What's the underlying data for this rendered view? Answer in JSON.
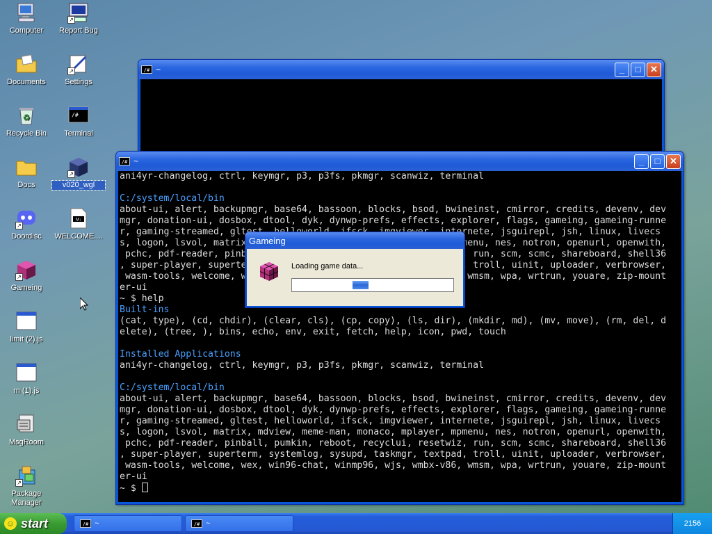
{
  "desktop": {
    "icons": [
      {
        "label": "Computer",
        "icon": "computer-icon"
      },
      {
        "label": "Report Bug",
        "icon": "report-bug-icon"
      },
      {
        "label": "Documents",
        "icon": "documents-icon"
      },
      {
        "label": "Settings",
        "icon": "settings-icon"
      },
      {
        "label": "Recycle Bin",
        "icon": "recycle-bin-icon"
      },
      {
        "label": "Terminal",
        "icon": "terminal-icon"
      },
      {
        "label": "Docs",
        "icon": "folder-icon"
      },
      {
        "label": "v020_wgl",
        "icon": "cube-icon"
      },
      {
        "label": "Doordisc",
        "icon": "doordisc-icon"
      },
      {
        "label": "WELCOME....",
        "icon": "markdown-file-icon"
      },
      {
        "label": "Gameing",
        "icon": "gameing-icon"
      },
      {
        "label": "limit (2).js",
        "icon": "js-file-icon"
      },
      {
        "label": "m (1).js",
        "icon": "js-file-icon"
      },
      {
        "label": "MsgRoom",
        "icon": "msgroom-icon"
      },
      {
        "label": "Package Manager",
        "icon": "package-manager-icon"
      }
    ]
  },
  "back_window": {
    "title": "~",
    "app_icon": "/#"
  },
  "front_window": {
    "title": "~",
    "app_icon": "/#",
    "lines": [
      {
        "text": "ani4yr-changelog, ctrl, keymgr, p3, p3fs, pkmgr, scanwiz, terminal",
        "style": "normal"
      },
      {
        "text": "",
        "style": "normal"
      },
      {
        "text": "C:/system/local/bin",
        "style": "blue"
      },
      {
        "text": "about-ui, alert, backupmgr, base64, bassoon, blocks, bsod, bwineinst, cmirror, credits, devenv, dev",
        "style": "normal"
      },
      {
        "text": "mgr, donation-ui, dosbox, dtool, dyk, dynwp-prefs, effects, explorer, flags, gameing, gameing-runne",
        "style": "normal"
      },
      {
        "text": "r, gaming-streamed, gltest, helloworld, ifsck, imgviewer, internete, jsguirepl, jsh, linux, livecs",
        "style": "normal"
      },
      {
        "text": "s, logon, lsvol, matrix, mdview, meme-man, monaco, mplayer, mpmenu, nes, notron, openurl, openwith,",
        "style": "normal"
      },
      {
        "text": " pchc, pdf-reader, pinball, pumkin, reboot, recyclui, resetwiz, run, scm, scmc, shareboard, shell36",
        "style": "normal"
      },
      {
        "text": ", super-player, superterm, systemlog, sysupd, taskmgr, textpad, troll, uinit, uploader, verbrowser,",
        "style": "normal"
      },
      {
        "text": " wasm-tools, welcome, wex, win96-chat, winmp96, wjs, wmbx-v86, wmsm, wpa, wrtrun, youare, zip-mount",
        "style": "normal"
      },
      {
        "text": "er-ui",
        "style": "normal"
      },
      {
        "text": "~ $ help",
        "style": "normal"
      },
      {
        "text": "Built-ins",
        "style": "blue"
      },
      {
        "text": "(cat, type), (cd, chdir), (clear, cls), (cp, copy), (ls, dir), (mkdir, md), (mv, move), (rm, del, d",
        "style": "normal"
      },
      {
        "text": "elete), (tree, ), bins, echo, env, exit, fetch, help, icon, pwd, touch",
        "style": "normal"
      },
      {
        "text": "",
        "style": "normal"
      },
      {
        "text": "Installed Applications",
        "style": "blue"
      },
      {
        "text": "ani4yr-changelog, ctrl, keymgr, p3, p3fs, pkmgr, scanwiz, terminal",
        "style": "normal"
      },
      {
        "text": "",
        "style": "normal"
      },
      {
        "text": "C:/system/local/bin",
        "style": "blue"
      },
      {
        "text": "about-ui, alert, backupmgr, base64, bassoon, blocks, bsod, bwineinst, cmirror, credits, devenv, dev",
        "style": "normal"
      },
      {
        "text": "mgr, donation-ui, dosbox, dtool, dyk, dynwp-prefs, effects, explorer, flags, gameing, gameing-runne",
        "style": "normal"
      },
      {
        "text": "r, gaming-streamed, gltest, helloworld, ifsck, imgviewer, internete, jsguirepl, jsh, linux, livecs",
        "style": "normal"
      },
      {
        "text": "s, logon, lsvol, matrix, mdview, meme-man, monaco, mplayer, mpmenu, nes, notron, openurl, openwith,",
        "style": "normal"
      },
      {
        "text": " pchc, pdf-reader, pinball, pumkin, reboot, recyclui, resetwiz, run, scm, scmc, shareboard, shell36",
        "style": "normal"
      },
      {
        "text": ", super-player, superterm, systemlog, sysupd, taskmgr, textpad, troll, uinit, uploader, verbrowser,",
        "style": "normal"
      },
      {
        "text": " wasm-tools, welcome, wex, win96-chat, winmp96, wjs, wmbx-v86, wmsm, wpa, wrtrun, youare, zip-mount",
        "style": "normal"
      },
      {
        "text": "er-ui",
        "style": "normal"
      }
    ],
    "prompt": "~ $ "
  },
  "dialog": {
    "title": "Gameing",
    "message": "Loading game data...",
    "progress_start": 0.37,
    "progress_end": 0.47
  },
  "taskbar": {
    "start_label": "start",
    "tasks": [
      {
        "label": "~",
        "icon": "/#"
      },
      {
        "label": "~",
        "icon": "/#"
      }
    ],
    "clock": "2156"
  },
  "colors": {
    "accent_blue": "#4aa0ff",
    "titlebar": "#1f5bd6",
    "start_green": "#3a9b32"
  }
}
